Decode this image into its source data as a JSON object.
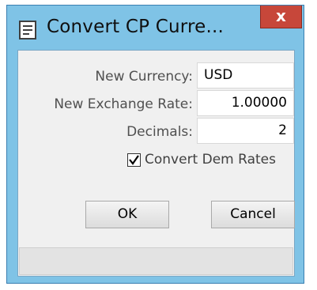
{
  "window": {
    "title": "Convert CP Curre...",
    "close_label": "x",
    "title_icon": "document-icon"
  },
  "form": {
    "currency_label": "New Currency:",
    "currency_value": "USD",
    "rate_label": "New Exchange Rate:",
    "rate_value": "1.00000",
    "decimals_label": "Decimals:",
    "decimals_value": "2",
    "convert_dem_label": "Convert Dem Rates",
    "convert_dem_checked": true
  },
  "buttons": {
    "ok": "OK",
    "cancel": "Cancel"
  },
  "colors": {
    "title_bar": "#7fc3e6",
    "close_button": "#c7473a",
    "client_background": "#f0f0f0"
  }
}
